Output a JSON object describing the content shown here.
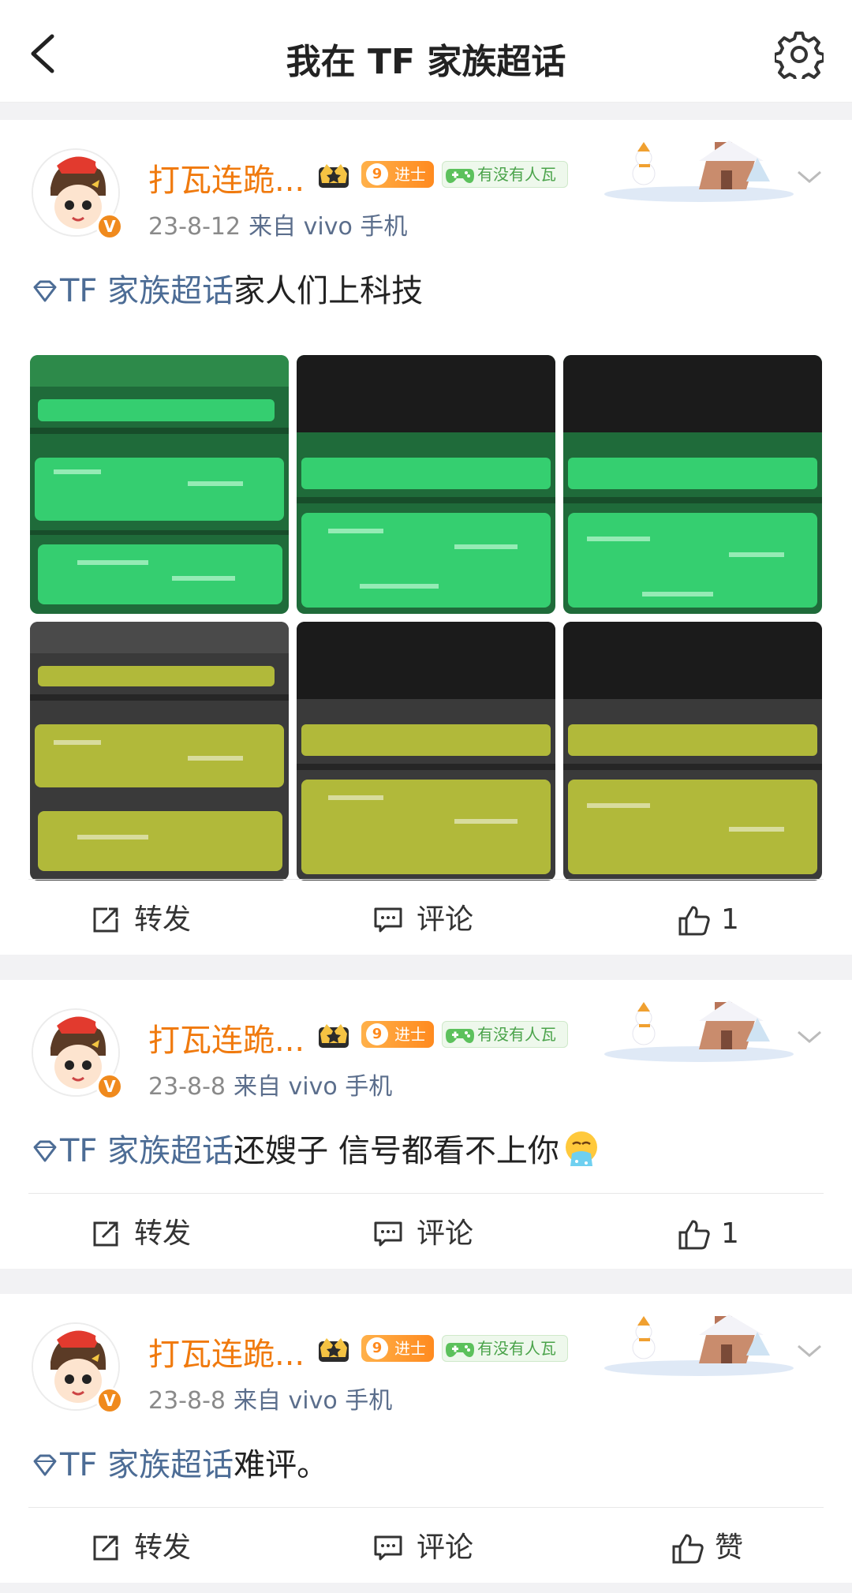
{
  "header": {
    "title": "我在 TF 家族超话",
    "back_icon": "chevron-left-icon",
    "settings_icon": "gear-icon"
  },
  "posts": [
    {
      "author": "打瓦连跪...",
      "level": "9",
      "level_label": "进士",
      "fan_label": "有没有人瓦",
      "time": "23-8-12",
      "source": "来自 vivo 手机",
      "tag": "TF 家族超话",
      "text": "家人们上科技",
      "repost": "转发",
      "comment": "评论",
      "like": "1"
    },
    {
      "author": "打瓦连跪...",
      "level": "9",
      "level_label": "进士",
      "fan_label": "有没有人瓦",
      "time": "23-8-8",
      "source": "来自 vivo 手机",
      "tag": "TF 家族超话",
      "text": "还嫂子 信号都看不上你",
      "repost": "转发",
      "comment": "评论",
      "like": "1"
    },
    {
      "author": "打瓦连跪...",
      "level": "9",
      "level_label": "进士",
      "fan_label": "有没有人瓦",
      "time": "23-8-8",
      "source": "来自 vivo 手机",
      "tag": "TF 家族超话",
      "text": "难评。",
      "repost": "转发",
      "comment": "评论",
      "like": "赞"
    }
  ],
  "colors": {
    "accent_name": "#f07a0e",
    "tag_blue": "#4c6c95",
    "green_lightstick": "#2ecf6a",
    "yellow_lightstick": "#e4f03a"
  }
}
